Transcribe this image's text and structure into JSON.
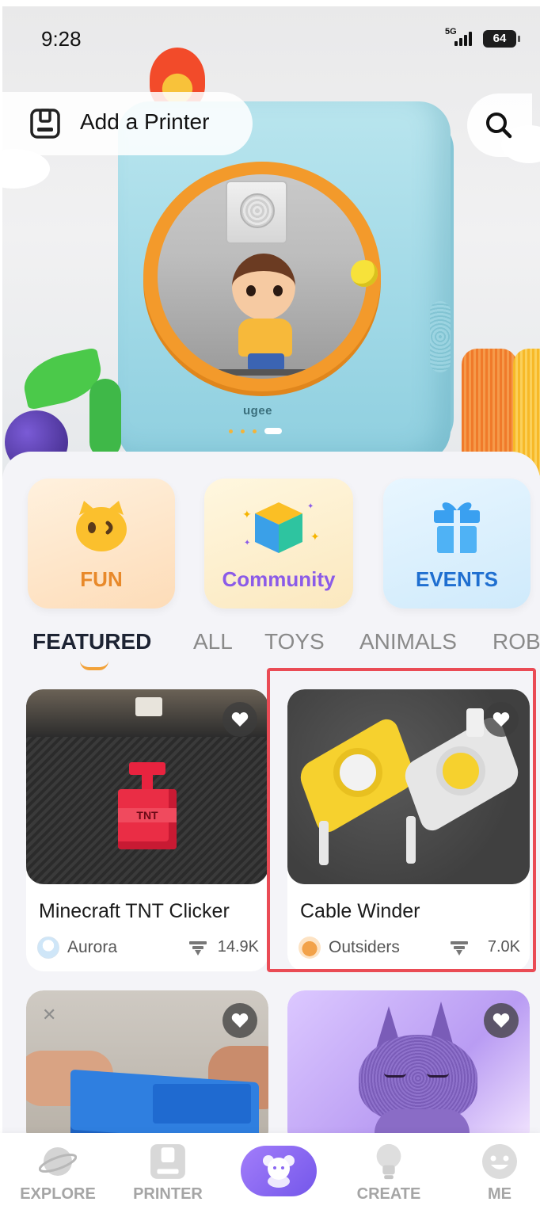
{
  "status": {
    "time": "9:28",
    "network": "5G",
    "battery": "64"
  },
  "header": {
    "add_printer_label": "Add a Printer"
  },
  "hero": {
    "brand": "ugee"
  },
  "categories": [
    {
      "label": "FUN",
      "icon": "cat-face-icon",
      "color": "#e8892a"
    },
    {
      "label": "Community",
      "icon": "cube-icon",
      "color": "#8b5be8"
    },
    {
      "label": "EVENTS",
      "icon": "gift-icon",
      "color": "#1f6fd0"
    }
  ],
  "tabs": [
    {
      "label": "FEATURED",
      "active": true
    },
    {
      "label": "ALL",
      "active": false
    },
    {
      "label": "TOYS",
      "active": false
    },
    {
      "label": "ANIMALS",
      "active": false
    },
    {
      "label": "ROB",
      "active": false
    }
  ],
  "cards": [
    {
      "title": "Minecraft TNT Clicker",
      "author": "Aurora",
      "downloads": "14.9K",
      "image": "tnt-block-photo"
    },
    {
      "title": "Cable Winder",
      "author": "Outsiders",
      "downloads": "7.0K",
      "image": "cable-winder-photo"
    },
    {
      "title": "",
      "author": "",
      "downloads": "",
      "image": "blue-box-photo"
    },
    {
      "title": "",
      "author": "",
      "downloads": "",
      "image": "knitted-fox-photo"
    }
  ],
  "nav": [
    {
      "label": "EXPLORE",
      "icon": "planet-icon"
    },
    {
      "label": "PRINTER",
      "icon": "printer-icon"
    },
    {
      "label": "",
      "icon": "bear-icon"
    },
    {
      "label": "CREATE",
      "icon": "lightbulb-icon"
    },
    {
      "label": "ME",
      "icon": "smiley-icon"
    }
  ],
  "colors": {
    "accent": "#f2a23a",
    "highlight": "#ea4b55",
    "nav_center": "#8a67f2"
  }
}
